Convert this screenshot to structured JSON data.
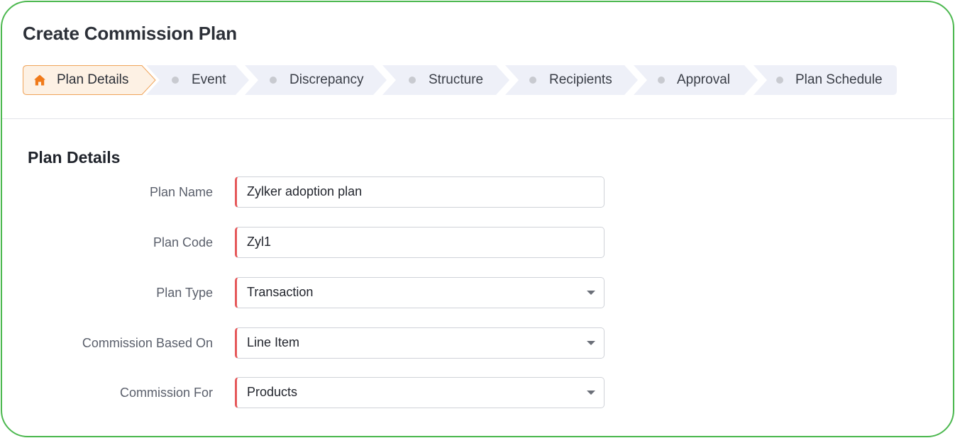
{
  "page": {
    "title": "Create Commission Plan"
  },
  "stepper": {
    "steps": [
      {
        "label": "Plan Details",
        "state": "active",
        "icon": "home-icon"
      },
      {
        "label": "Event",
        "state": "pending"
      },
      {
        "label": "Discrepancy",
        "state": "pending"
      },
      {
        "label": "Structure",
        "state": "pending"
      },
      {
        "label": "Recipients",
        "state": "pending"
      },
      {
        "label": "Approval",
        "state": "pending"
      },
      {
        "label": "Plan Schedule",
        "state": "pending"
      }
    ]
  },
  "form": {
    "section_title": "Plan Details",
    "fields": [
      {
        "label": "Plan Name",
        "value": "Zylker adoption plan",
        "type": "text",
        "required": true
      },
      {
        "label": "Plan Code",
        "value": "Zyl1",
        "type": "text",
        "required": true
      },
      {
        "label": "Plan Type",
        "value": "Transaction",
        "type": "select",
        "required": true
      },
      {
        "label": "Commission Based On",
        "value": "Line Item",
        "type": "select",
        "required": true
      },
      {
        "label": "Commission For",
        "value": "Products",
        "type": "select",
        "required": true
      }
    ]
  },
  "colors": {
    "frame_border": "#4cb84f",
    "active_step_fill": "#fdf1e4",
    "active_step_border": "#f0a45a",
    "home_icon": "#f07a1a",
    "pending_step_fill": "#eef0f8",
    "required_marker": "#e5595b"
  }
}
